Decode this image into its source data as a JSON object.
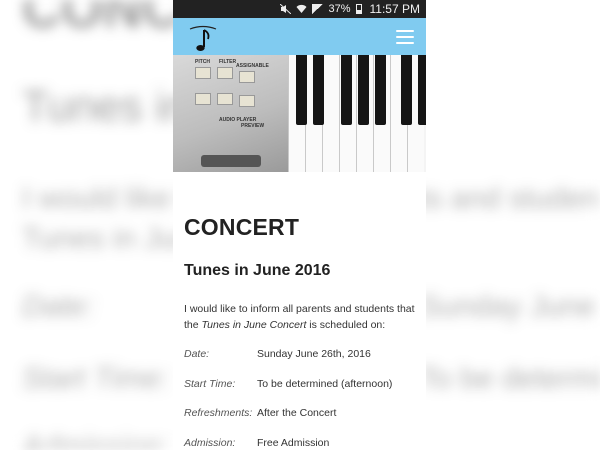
{
  "status_bar": {
    "battery_percent": "37%",
    "time": "11:57 PM"
  },
  "page": {
    "title": "CONCERT",
    "subtitle": "Tunes in June 2016",
    "intro_part1": "I would like to inform all parents and students that the ",
    "intro_em": "Tunes in June Concert",
    "intro_part2": " is scheduled on:",
    "details": [
      {
        "label": "Date:",
        "value": "Sunday June 26th, 2016"
      },
      {
        "label": "Start Time:",
        "value": "To be determined (afternoon)"
      },
      {
        "label": "Refreshments:",
        "value": "After the Concert"
      },
      {
        "label": "Admission:",
        "value": "Free Admission"
      }
    ]
  },
  "hero": {
    "panel_labels": [
      "PITCH",
      "FILTER",
      "ASSIGNABLE",
      "AUDIO PLAYER",
      "PREVIEW"
    ]
  },
  "colors": {
    "app_bar": "#80cbf0",
    "status_bar": "#222222"
  },
  "icons": {
    "menu": "hamburger-icon",
    "logo": "music-note-logo"
  }
}
